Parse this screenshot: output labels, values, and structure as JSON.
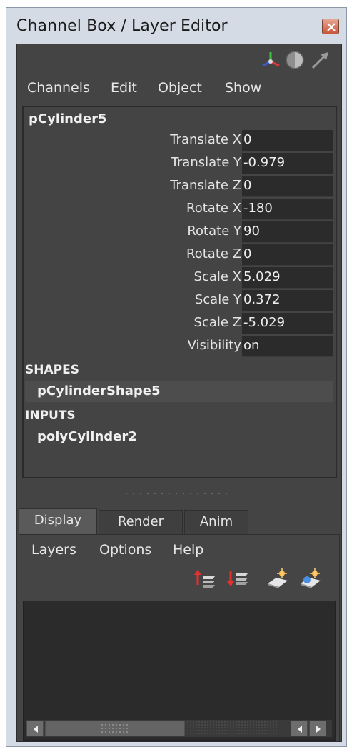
{
  "window": {
    "title": "Channel Box / Layer Editor"
  },
  "channel_box": {
    "menu": [
      "Channels",
      "Edit",
      "Object",
      "Show"
    ],
    "object_name": "pCylinder5",
    "attributes": [
      {
        "label": "Translate X",
        "value": "0"
      },
      {
        "label": "Translate Y",
        "value": "-0.979"
      },
      {
        "label": "Translate Z",
        "value": "0"
      },
      {
        "label": "Rotate X",
        "value": "-180"
      },
      {
        "label": "Rotate Y",
        "value": "90"
      },
      {
        "label": "Rotate Z",
        "value": "0"
      },
      {
        "label": "Scale X",
        "value": "5.029"
      },
      {
        "label": "Scale Y",
        "value": "0.372"
      },
      {
        "label": "Scale Z",
        "value": "-5.029"
      },
      {
        "label": "Visibility",
        "value": "on"
      }
    ],
    "shapes_header": "SHAPES",
    "shape_node": "pCylinderShape5",
    "inputs_header": "INPUTS",
    "input_node": "polyCylinder2"
  },
  "layer_editor": {
    "tabs": [
      "Display",
      "Render",
      "Anim"
    ],
    "active_tab": "Display",
    "menu": [
      "Layers",
      "Options",
      "Help"
    ]
  },
  "colors": {
    "window_bg": "#d4dbe5",
    "panel_bg": "#444444",
    "field_bg": "#2b2b2b",
    "text": "#e6e6e6",
    "close_red": "#c9553a"
  },
  "icons": {
    "top": [
      "axis-manipulator-icon",
      "channel-speed-icon",
      "arrow-pointer-icon"
    ],
    "layer_toolbar": [
      "move-layer-up-icon",
      "move-layer-down-icon",
      "new-empty-layer-icon",
      "new-layer-from-selected-icon"
    ]
  }
}
